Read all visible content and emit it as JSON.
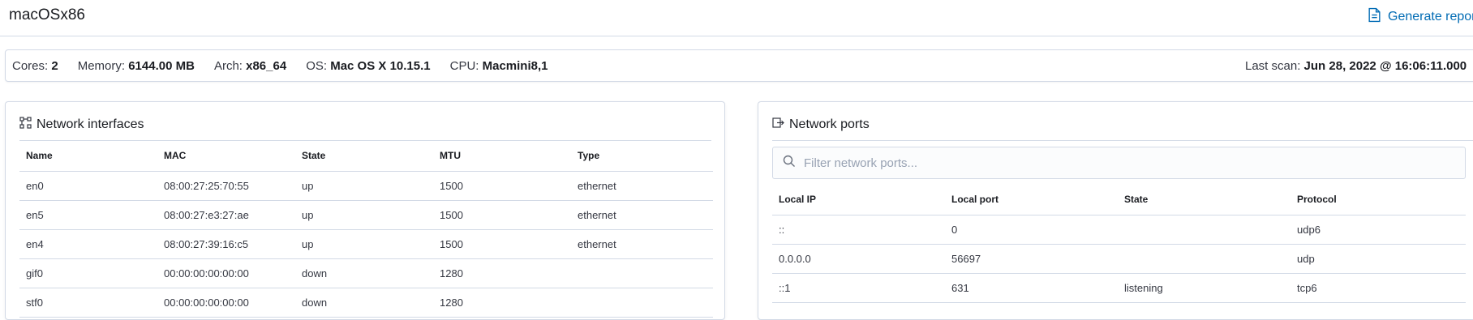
{
  "header": {
    "title": "macOSx86",
    "generate_report_label": "Generate report"
  },
  "info": {
    "cores_label": "Cores:",
    "cores_value": "2",
    "memory_label": "Memory:",
    "memory_value": "6144.00 MB",
    "arch_label": "Arch:",
    "arch_value": "x86_64",
    "os_label": "OS:",
    "os_value": "Mac OS X 10.15.1",
    "cpu_label": "CPU:",
    "cpu_value": "Macmini8,1",
    "scan_label": "Last scan:",
    "scan_value": "Jun 28, 2022 @ 16:06:11.000"
  },
  "interfaces": {
    "title": "Network interfaces",
    "columns": [
      "Name",
      "MAC",
      "State",
      "MTU",
      "Type"
    ],
    "rows": [
      [
        "en0",
        "08:00:27:25:70:55",
        "up",
        "1500",
        "ethernet"
      ],
      [
        "en5",
        "08:00:27:e3:27:ae",
        "up",
        "1500",
        "ethernet"
      ],
      [
        "en4",
        "08:00:27:39:16:c5",
        "up",
        "1500",
        "ethernet"
      ],
      [
        "gif0",
        "00:00:00:00:00:00",
        "down",
        "1280",
        ""
      ],
      [
        "stf0",
        "00:00:00:00:00:00",
        "down",
        "1280",
        ""
      ]
    ]
  },
  "ports": {
    "title": "Network ports",
    "search_placeholder": "Filter network ports...",
    "columns": [
      "Local IP",
      "Local port",
      "State",
      "Protocol"
    ],
    "rows": [
      [
        "::",
        "0",
        "",
        "udp6"
      ],
      [
        "0.0.0.0",
        "56697",
        "",
        "udp"
      ],
      [
        "::1",
        "631",
        "listening",
        "tcp6"
      ]
    ]
  },
  "colors": {
    "accent": "#006bb4",
    "border": "#d3dae6",
    "text": "#343741"
  },
  "icons": {
    "report": "document-icon",
    "interfaces": "network-icon",
    "ports": "port-export-icon",
    "search": "search-icon"
  }
}
